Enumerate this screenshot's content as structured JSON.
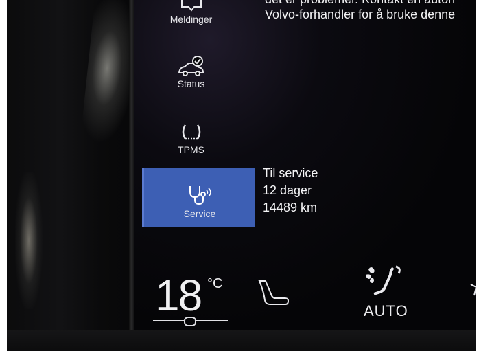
{
  "message": {
    "line1": "det er problemer. Kontakt en autori",
    "line2": "Volvo-forhandler for å bruke denne"
  },
  "menu": {
    "items": [
      {
        "label": "Meldinger",
        "icon": "message-car-icon"
      },
      {
        "label": "Status",
        "icon": "car-check-icon"
      },
      {
        "label": "TPMS",
        "icon": "tire-pressure-icon"
      },
      {
        "label": "Service",
        "icon": "stethoscope-icon",
        "active": true
      }
    ]
  },
  "service": {
    "title": "Til service",
    "days": "12 dager",
    "distance": "14489 km"
  },
  "climate": {
    "temperature": "18",
    "unit": "°C",
    "auto_label": "AUTO"
  },
  "colors": {
    "active_tab": "#3d5fb4",
    "screen_bg": "#050507",
    "text": "#f0f0f2"
  }
}
